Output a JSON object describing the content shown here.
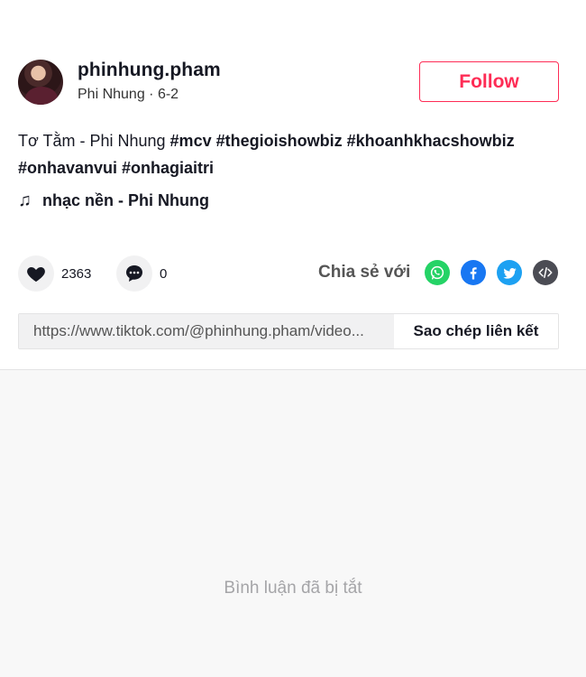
{
  "author": {
    "username": "phinhung.pham",
    "display_name": "Phi Nhung",
    "date": "6-2",
    "separator": " · "
  },
  "follow_button": {
    "label": "Follow"
  },
  "description": {
    "text": "Tơ Tằm - Phi Nhung",
    "hashtags": [
      "#mcv",
      "#thegioishowbiz",
      "#khoanhkhacshowbiz",
      "#onhavanvui",
      "#onhagiaitri"
    ]
  },
  "music": {
    "label": "nhạc nền - Phi Nhung",
    "icon": "music-note-icon"
  },
  "stats": {
    "likes": "2363",
    "comments": "0"
  },
  "share": {
    "label": "Chia sẻ với",
    "targets": [
      "whatsapp-icon",
      "facebook-icon",
      "twitter-icon",
      "embed-icon"
    ],
    "colors": {
      "whatsapp": "#25d366",
      "facebook": "#1877f2",
      "twitter": "#1da1f2",
      "embed": "#4b4c54"
    }
  },
  "link": {
    "url": "https://www.tiktok.com/@phinhung.pham/video...",
    "copy_label": "Sao chép liên kết"
  },
  "comments": {
    "disabled_text": "Bình luận đã bị tắt"
  },
  "colors": {
    "accent": "#fe2c55",
    "text": "#161823",
    "muted": "#a5a5a8"
  }
}
